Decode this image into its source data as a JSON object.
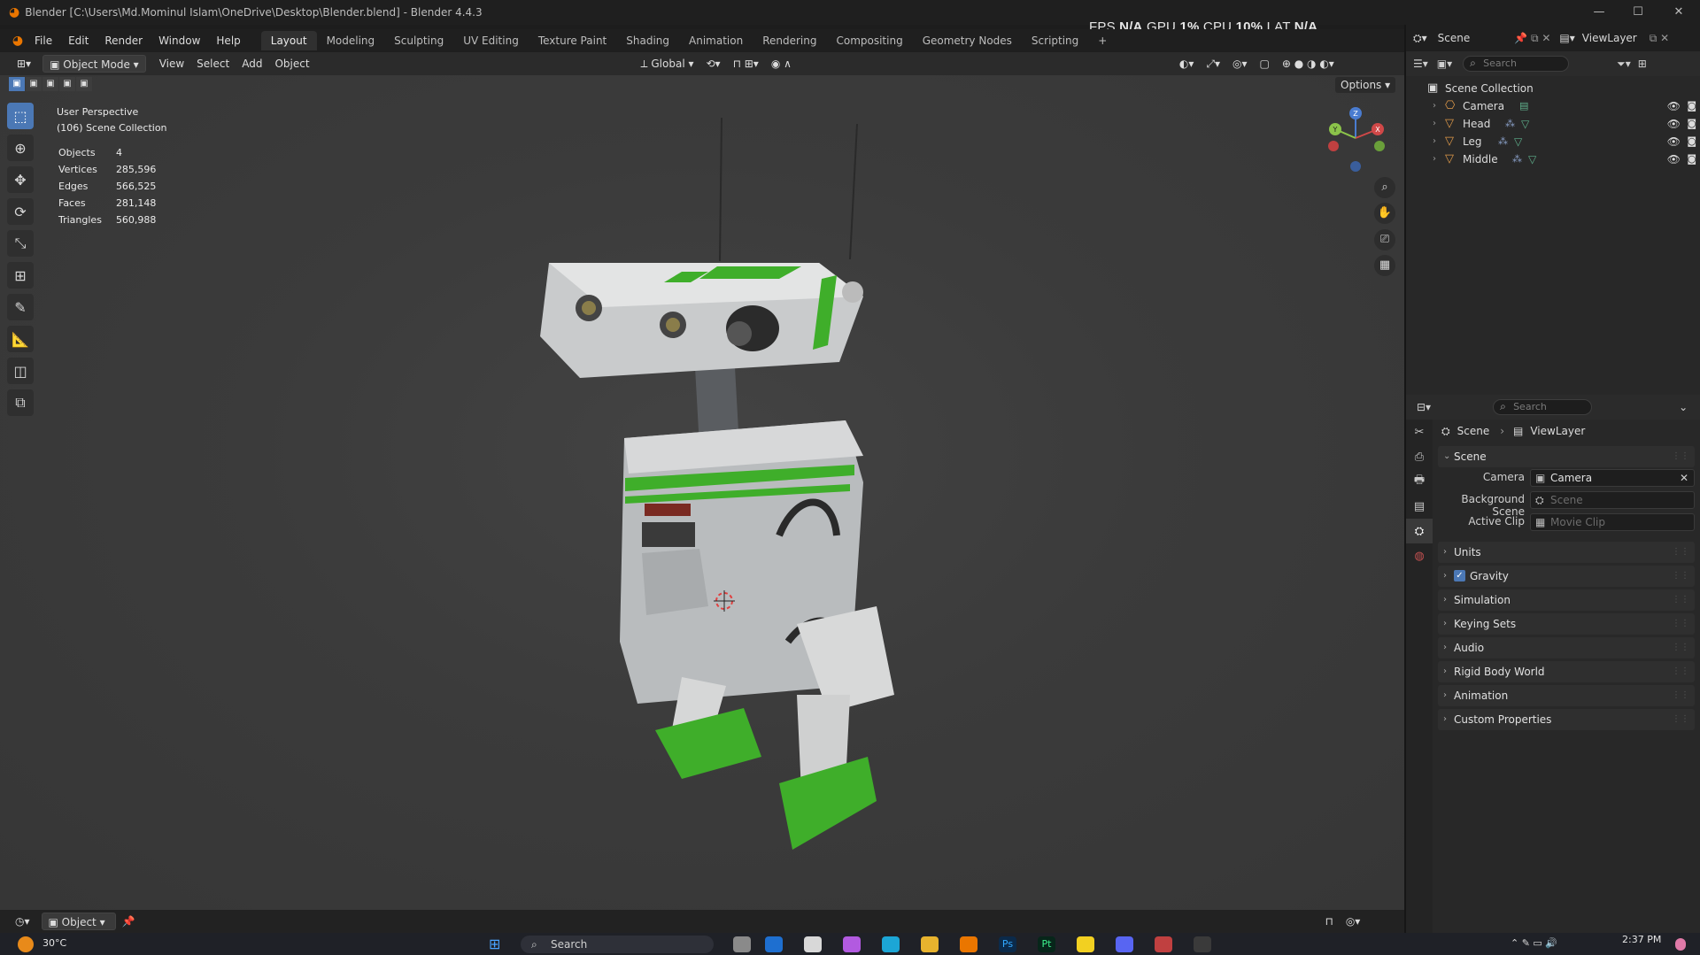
{
  "window": {
    "title": "Blender [C:\\Users\\Md.Mominul Islam\\OneDrive\\Desktop\\Blender.blend] - Blender 4.4.3"
  },
  "perf": {
    "fps_label": "FPS",
    "fps_value": "N/A",
    "gpu_label": "GPU",
    "gpu_value": "1%",
    "cpu_label": "CPU",
    "cpu_value": "10%",
    "lat_label": "LAT",
    "lat_value": "N/A"
  },
  "menu": [
    "File",
    "Edit",
    "Render",
    "Window",
    "Help"
  ],
  "workspaces": [
    "Layout",
    "Modeling",
    "Sculpting",
    "UV Editing",
    "Texture Paint",
    "Shading",
    "Animation",
    "Rendering",
    "Compositing",
    "Geometry Nodes",
    "Scripting"
  ],
  "active_workspace": "Layout",
  "viewport_header": {
    "mode": "Object Mode",
    "menus": [
      "View",
      "Select",
      "Add",
      "Object"
    ],
    "transform": "Global",
    "options": "Options"
  },
  "viewport": {
    "perspective": "User Perspective",
    "collection": "(106) Scene Collection"
  },
  "stats": [
    {
      "label": "Objects",
      "value": "4"
    },
    {
      "label": "Vertices",
      "value": "285,596"
    },
    {
      "label": "Edges",
      "value": "566,525"
    },
    {
      "label": "Faces",
      "value": "281,148"
    },
    {
      "label": "Triangles",
      "value": "560,988"
    }
  ],
  "top_right": {
    "scene": "Scene",
    "view_layer": "ViewLayer"
  },
  "outliner": {
    "search_placeholder": "Search",
    "root": "Scene Collection",
    "items": [
      "Camera",
      "Head",
      "Leg",
      "Middle"
    ]
  },
  "properties": {
    "search_placeholder": "Search",
    "breadcrumb": [
      "Scene",
      "ViewLayer"
    ],
    "panel_scene": "Scene",
    "fields": [
      {
        "label": "Camera",
        "value": "Camera",
        "placeholder": false
      },
      {
        "label": "Background Scene",
        "value": "Scene",
        "placeholder": true
      },
      {
        "label": "Active Clip",
        "value": "Movie Clip",
        "placeholder": true
      }
    ],
    "panels": [
      "Units",
      "Gravity",
      "Simulation",
      "Keying Sets",
      "Audio",
      "Rigid Body World",
      "Animation",
      "Custom Properties"
    ]
  },
  "statusbar": {
    "mode": "Object"
  },
  "taskbar": {
    "temp": "30°C",
    "search": "Search",
    "time": "2:37 PM"
  },
  "colors": {
    "accent": "#4b78b5",
    "blender_orange": "#ea7600",
    "robot_green": "#3fae2a"
  }
}
